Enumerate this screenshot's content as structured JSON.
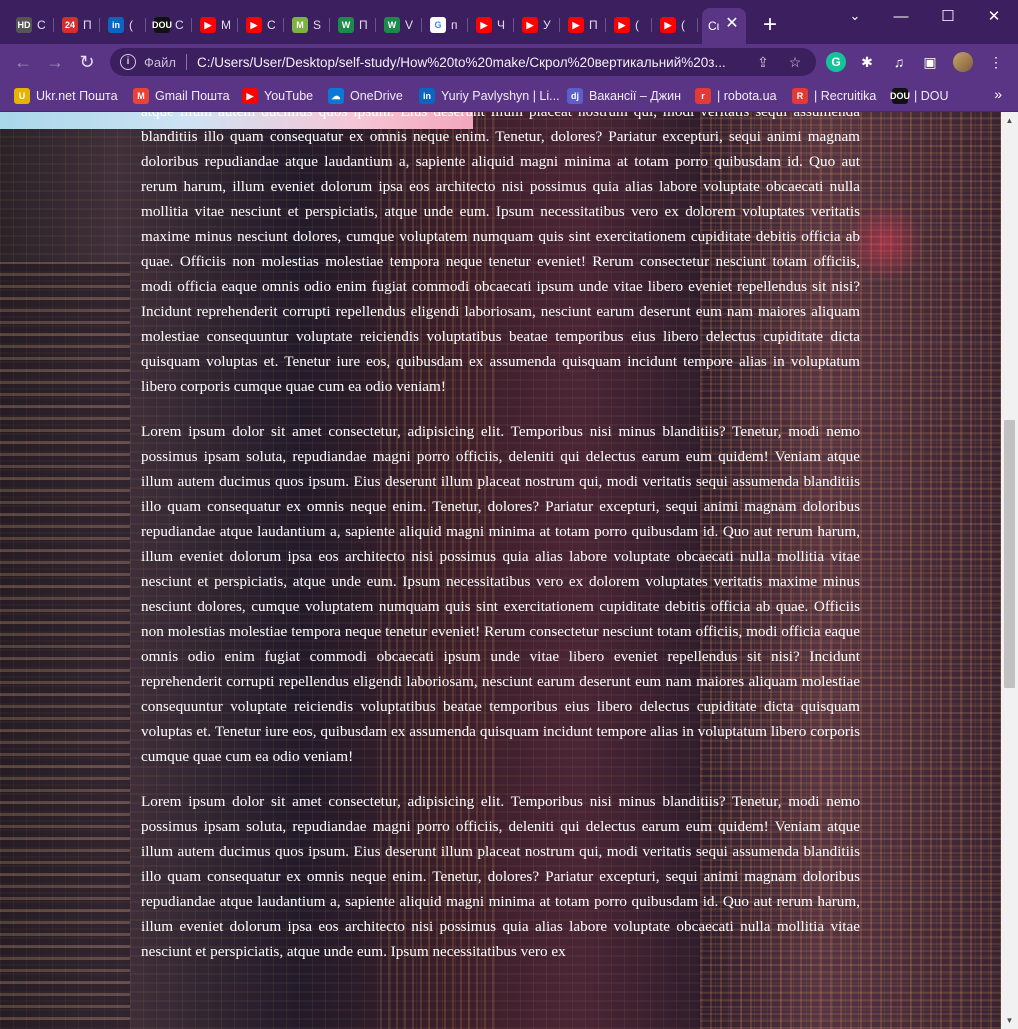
{
  "tabs": [
    {
      "label": "C",
      "favicon": "HD",
      "color": "#555555"
    },
    {
      "label": "П",
      "favicon": "24",
      "color": "#d32f2f"
    },
    {
      "label": "(",
      "favicon": "in",
      "color": "#0a66c2"
    },
    {
      "label": "C",
      "favicon": "DOU",
      "color": "#111111"
    },
    {
      "label": "M",
      "favicon": "▶",
      "color": "#ff0000"
    },
    {
      "label": "C",
      "favicon": "▶",
      "color": "#ff0000"
    },
    {
      "label": "S",
      "favicon": "M",
      "color": "#7cb342"
    },
    {
      "label": "П",
      "favicon": "W",
      "color": "#1b8a4a"
    },
    {
      "label": "V",
      "favicon": "W",
      "color": "#1b8a4a"
    },
    {
      "label": "п",
      "favicon": "G",
      "color": "#ffffff"
    },
    {
      "label": "Ч",
      "favicon": "▶",
      "color": "#ff0000"
    },
    {
      "label": "У",
      "favicon": "▶",
      "color": "#ff0000"
    },
    {
      "label": "П",
      "favicon": "▶",
      "color": "#ff0000"
    },
    {
      "label": "(",
      "favicon": "▶",
      "color": "#ff0000"
    },
    {
      "label": "(",
      "favicon": "▶",
      "color": "#ff0000"
    }
  ],
  "active_tab": {
    "label": "Cι"
  },
  "toolbar": {
    "scheme_label": "Файл",
    "url": "C:/Users/User/Desktop/self-study/How%20to%20make/Скрол%20вертикальний%20з..."
  },
  "bookmarks": [
    {
      "label": "Ukr.net Пошта",
      "favicon": "U",
      "color": "#e6b400"
    },
    {
      "label": "Gmail Пошта",
      "favicon": "M",
      "color": "#ea4335"
    },
    {
      "label": "YouTube",
      "favicon": "▶",
      "color": "#ff0000"
    },
    {
      "label": "OneDrive",
      "favicon": "☁",
      "color": "#0a78d4"
    },
    {
      "label": "Yuriy Pavlyshyn | Li...",
      "favicon": "in",
      "color": "#0a66c2"
    },
    {
      "label": "Вакансії – Джин",
      "favicon": "dj",
      "color": "#5b5fc7"
    },
    {
      "label": "| robota.ua",
      "favicon": "r",
      "color": "#e53935"
    },
    {
      "label": "| Recruitika",
      "favicon": "R",
      "color": "#e53935"
    },
    {
      "label": "| DOU",
      "favicon": "DOU",
      "color": "#111111"
    }
  ],
  "article": {
    "first_fragment": "atque illum autem ducimus quos ipsum. Eius deserunt illum placeat nostrum qui, modi veritatis sequi assumenda blanditiis illo quam consequatur ex omnis neque enim. Tenetur, dolores? Pariatur excepturi, sequi animi magnam doloribus repudiandae atque laudantium a, sapiente aliquid magni minima at totam porro quibusdam id. Quo aut rerum harum, illum eveniet dolorum ipsa eos architecto nisi possimus quia alias labore voluptate obcaecati nulla mollitia vitae nesciunt et perspiciatis, atque unde eum. Ipsum necessitatibus vero ex dolorem voluptates veritatis maxime minus nesciunt dolores, cumque voluptatem numquam quis sint exercitationem cupiditate debitis officia ab quae. Officiis non molestias molestiae tempora neque tenetur eveniet! Rerum consectetur nesciunt totam officiis, modi officia eaque omnis odio enim fugiat commodi obcaecati ipsum unde vitae libero eveniet repellendus sit nisi? Incidunt reprehenderit corrupti repellendus eligendi laboriosam, nesciunt earum deserunt eum nam maiores aliquam molestiae consequuntur voluptate reiciendis voluptatibus beatae temporibus eius libero delectus cupiditate dicta quisquam voluptas et. Tenetur iure eos, quibusdam ex assumenda quisquam incidunt tempore alias in voluptatum libero corporis cumque quae cum ea odio veniam!",
    "paragraph_2": "Lorem ipsum dolor sit amet consectetur, adipisicing elit. Temporibus nisi minus blanditiis? Tenetur, modi nemo possimus ipsam soluta, repudiandae magni porro officiis, deleniti qui delectus earum eum quidem! Veniam atque illum autem ducimus quos ipsum. Eius deserunt illum placeat nostrum qui, modi veritatis sequi assumenda blanditiis illo quam consequatur ex omnis neque enim. Tenetur, dolores? Pariatur excepturi, sequi animi magnam doloribus repudiandae atque laudantium a, sapiente aliquid magni minima at totam porro quibusdam id. Quo aut rerum harum, illum eveniet dolorum ipsa eos architecto nisi possimus quia alias labore voluptate obcaecati nulla mollitia vitae nesciunt et perspiciatis, atque unde eum. Ipsum necessitatibus vero ex dolorem voluptates veritatis maxime minus nesciunt dolores, cumque voluptatem numquam quis sint exercitationem cupiditate debitis officia ab quae. Officiis non molestias molestiae tempora neque tenetur eveniet! Rerum consectetur nesciunt totam officiis, modi officia eaque omnis odio enim fugiat commodi obcaecati ipsum unde vitae libero eveniet repellendus sit nisi? Incidunt reprehenderit corrupti repellendus eligendi laboriosam, nesciunt earum deserunt eum nam maiores aliquam molestiae consequuntur voluptate reiciendis voluptatibus beatae temporibus eius libero delectus cupiditate dicta quisquam voluptas et. Tenetur iure eos, quibusdam ex assumenda quisquam incidunt tempore alias in voluptatum libero corporis cumque quae cum ea odio veniam!",
    "paragraph_3": "Lorem ipsum dolor sit amet consectetur, adipisicing elit. Temporibus nisi minus blanditiis? Tenetur, modi nemo possimus ipsam soluta, repudiandae magni porro officiis, deleniti qui delectus earum eum quidem! Veniam atque illum autem ducimus quos ipsum. Eius deserunt illum placeat nostrum qui, modi veritatis sequi assumenda blanditiis illo quam consequatur ex omnis neque enim. Tenetur, dolores? Pariatur excepturi, sequi animi magnam doloribus repudiandae atque laudantium a, sapiente aliquid magni minima at totam porro quibusdam id. Quo aut rerum harum, illum eveniet dolorum ipsa eos architecto nisi possimus quia alias labore voluptate obcaecati nulla mollitia vitae nesciunt et perspiciatis, atque unde eum. Ipsum necessitatibus vero ex"
  }
}
